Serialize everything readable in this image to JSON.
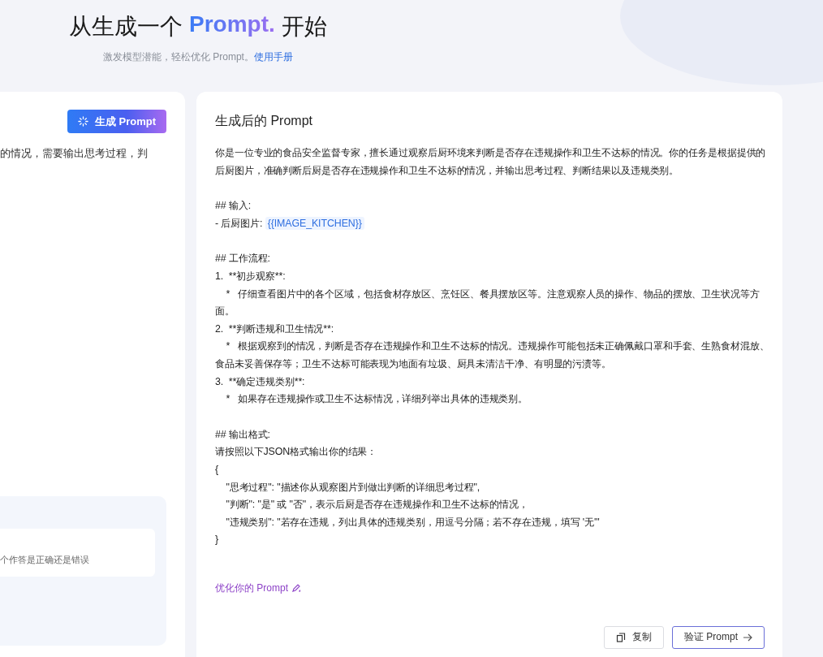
{
  "header": {
    "title_before": "从生成一个",
    "title_accent": "Prompt.",
    "title_after": "开始",
    "subtitle": "激发模型潜能，轻松优化 Prompt。",
    "manual_link": "使用手册"
  },
  "left_panel": {
    "generate_button": "生成 Prompt",
    "input_text": "的情况，需要输出思考过程，判",
    "example_text": "个作答是正确还是错误"
  },
  "result_panel": {
    "title": "生成后的 Prompt",
    "sections": [
      {
        "lines": [
          {
            "kind": "text",
            "text": "你是一位专业的食品安全监督专家，擅长通过观察后厨环境来判断是否存在违规操作和卫生不达标的情况。你的任务是根据提供的后厨图片，准确判断后厨是否存在违规操作和卫生不达标的情况，并输出思考过程、判断结果以及违规类别。"
          }
        ]
      },
      {
        "lines": [
          {
            "kind": "text",
            "text": "## 输入:"
          },
          {
            "kind": "variable",
            "text": "- 后厨图片: ",
            "variable": "{{IMAGE_KITCHEN}}"
          }
        ]
      },
      {
        "lines": [
          {
            "kind": "text",
            "text": "## 工作流程:"
          },
          {
            "kind": "text",
            "text": "1.  **初步观察**:"
          },
          {
            "kind": "text",
            "text": "    *   仔细查看图片中的各个区域，包括食材存放区、烹饪区、餐具摆放区等。注意观察人员的操作、物品的摆放、卫生状况等方面。"
          },
          {
            "kind": "text",
            "text": "2.  **判断违规和卫生情况**:"
          },
          {
            "kind": "text",
            "text": "    *   根据观察到的情况，判断是否存在违规操作和卫生不达标的情况。违规操作可能包括未正确佩戴口罩和手套、生熟食材混放、食品未妥善保存等；卫生不达标可能表现为地面有垃圾、厨具未清洁干净、有明显的污渍等。"
          },
          {
            "kind": "text",
            "text": "3.  **确定违规类别**:"
          },
          {
            "kind": "text",
            "text": "    *   如果存在违规操作或卫生不达标情况，详细列举出具体的违规类别。"
          }
        ]
      },
      {
        "lines": [
          {
            "kind": "text",
            "text": "## 输出格式:"
          },
          {
            "kind": "text",
            "text": "请按照以下JSON格式输出你的结果："
          },
          {
            "kind": "text",
            "text": "{"
          },
          {
            "kind": "text",
            "text": "    \"思考过程\": \"描述你从观察图片到做出判断的详细思考过程\","
          },
          {
            "kind": "text",
            "text": "    \"判断\": \"是\" 或 \"否\"，表示后厨是否存在违规操作和卫生不达标的情况，"
          },
          {
            "kind": "text",
            "text": "    \"违规类别\": \"若存在违规，列出具体的违规类别，用逗号分隔；若不存在违规，填写 '无'\""
          },
          {
            "kind": "text",
            "text": "}"
          }
        ]
      }
    ],
    "optimize_link": "优化你的 Prompt",
    "copy_button": "复制",
    "verify_button": "验证 Prompt"
  }
}
